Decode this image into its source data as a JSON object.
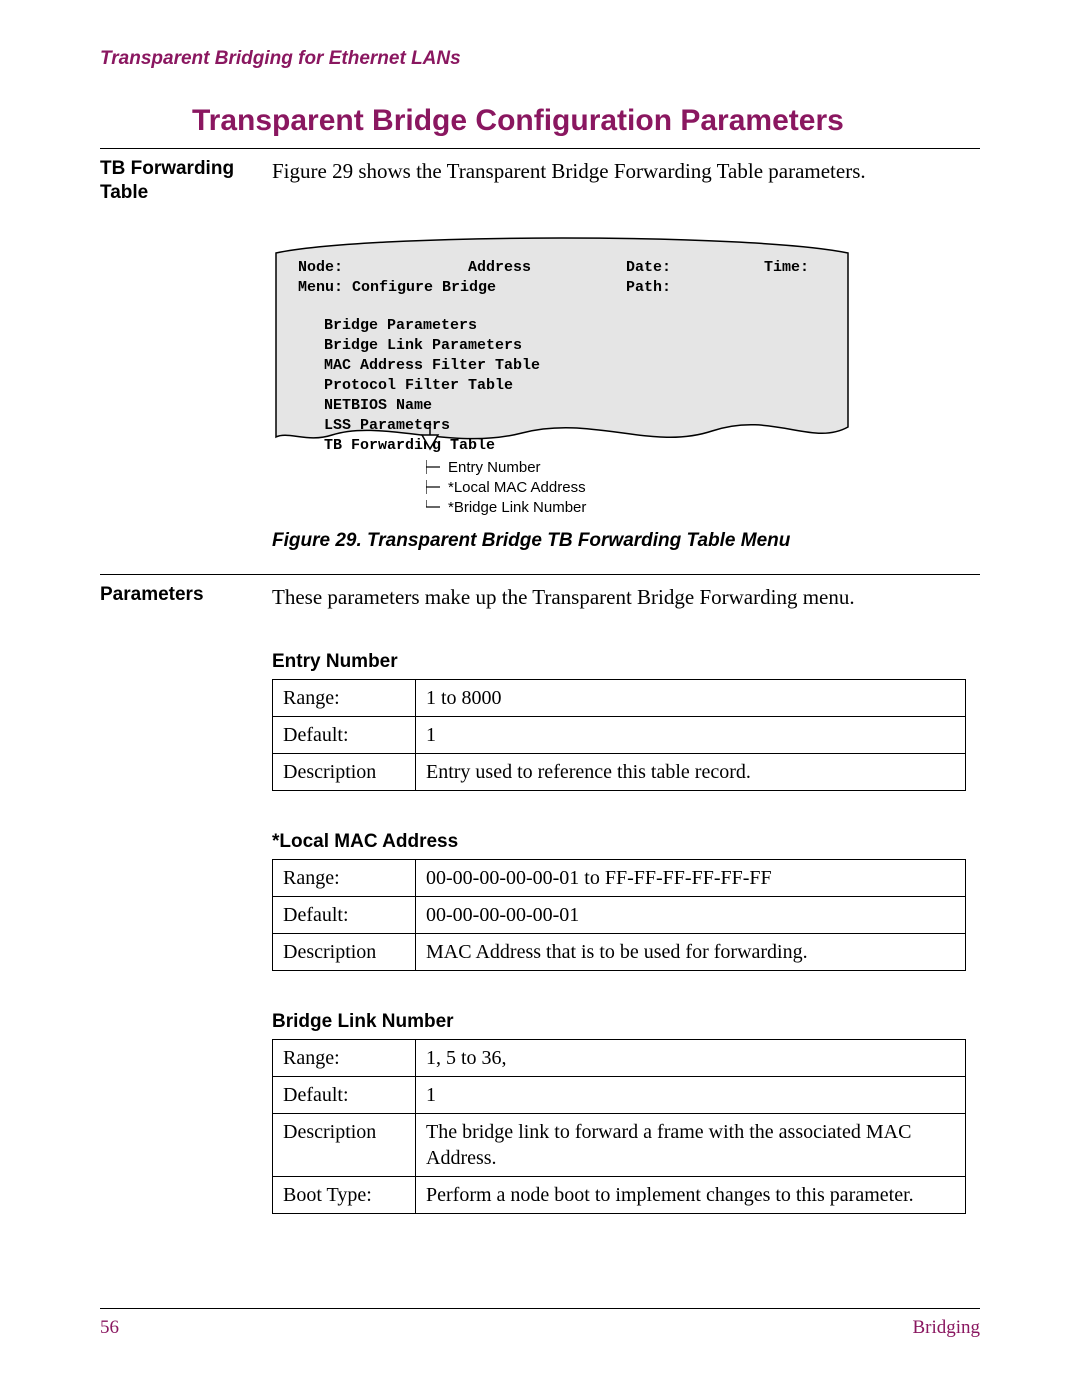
{
  "header": {
    "running": "Transparent Bridging for Ethernet LANs"
  },
  "title": "Transparent Bridge Configuration Parameters",
  "section1": {
    "side": "TB Forwarding Table",
    "body": "Figure 29 shows the Transparent Bridge Forwarding Table parameters."
  },
  "menu": {
    "row1": {
      "node": "Node:",
      "address": "Address",
      "date": "Date:",
      "time": "Time:"
    },
    "row2": {
      "menu": "Menu: Configure Bridge",
      "path": "Path:"
    },
    "items": [
      "Bridge Parameters",
      "Bridge Link Parameters",
      "MAC Address Filter Table",
      "Protocol Filter Table",
      "NETBIOS Name",
      "LSS Parameters",
      "TB Forwarding Table"
    ]
  },
  "callouts": [
    "Entry Number",
    "*Local MAC Address",
    "*Bridge Link Number"
  ],
  "figure_caption": "Figure 29. Transparent Bridge TB Forwarding Table Menu",
  "section2": {
    "side": "Parameters",
    "body": "These parameters make up the Transparent Bridge Forwarding menu."
  },
  "params": [
    {
      "heading": "Entry Number",
      "rows": [
        {
          "k": "Range:",
          "v": "1 to 8000"
        },
        {
          "k": "Default:",
          "v": "1"
        },
        {
          "k": "Description",
          "v": "Entry used to reference this table record."
        }
      ]
    },
    {
      "heading": "*Local MAC Address",
      "rows": [
        {
          "k": "Range:",
          "v": "00-00-00-00-00-01 to FF-FF-FF-FF-FF-FF"
        },
        {
          "k": "Default:",
          "v": "00-00-00-00-00-01"
        },
        {
          "k": "Description",
          "v": "MAC Address that is to be used for forwarding."
        }
      ]
    },
    {
      "heading": "Bridge Link Number",
      "rows": [
        {
          "k": "Range:",
          "v": "1, 5 to 36,"
        },
        {
          "k": "Default:",
          "v": "1"
        },
        {
          "k": "Description",
          "v": "The bridge link to forward a frame with the associated MAC Address."
        },
        {
          "k": "Boot Type:",
          "v": "Perform a node boot to implement changes to this parameter."
        }
      ]
    }
  ],
  "footer": {
    "page": "56",
    "section": "Bridging"
  }
}
